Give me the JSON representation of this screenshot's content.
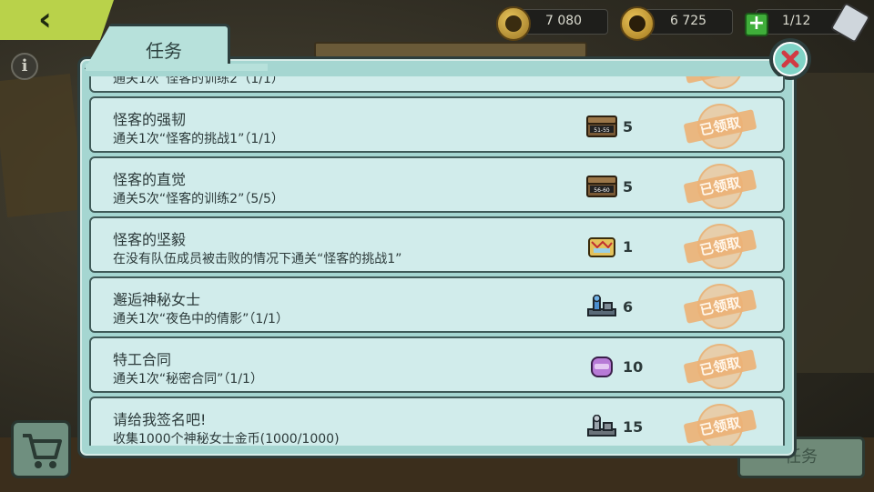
{
  "currencies": {
    "coin_a": {
      "amount": "7 080"
    },
    "coin_b": {
      "amount": "6 725"
    },
    "tickets": {
      "amount": "1/12"
    }
  },
  "dialog": {
    "title": "任务",
    "claimed_label": "已领取"
  },
  "tasks": [
    {
      "title": "",
      "desc": "通关1次“怪客的训练2”（1/1）",
      "reward_icon": "partial-hidden",
      "reward_count": ""
    },
    {
      "title": "怪客的强韧",
      "desc": "通关1次“怪客的挑战1”（1/1）",
      "reward_icon": "treasure-chest-icon",
      "chest_label": "51-55",
      "reward_count": "5"
    },
    {
      "title": "怪客的直觉",
      "desc": "通关5次“怪客的训练2”（5/5）",
      "reward_icon": "treasure-chest-icon",
      "chest_label": "56-60",
      "reward_count": "5"
    },
    {
      "title": "怪客的坚毅",
      "desc": "在没有队伍成员被击败的情况下通关“怪客的挑战1”",
      "reward_icon": "gold-case-icon",
      "reward_count": "1"
    },
    {
      "title": "邂逅神秘女士",
      "desc": "通关1次“夜色中的倩影”（1/1）",
      "reward_icon": "blue-figure-icon",
      "reward_count": "6"
    },
    {
      "title": "特工合同",
      "desc": "通关1次“秘密合同”（1/1）",
      "reward_icon": "purple-pouch-icon",
      "reward_count": "10"
    },
    {
      "title": "请给我签名吧!",
      "desc": "收集1000个神秘女士金币(1000/1000)",
      "reward_icon": "grey-figure-icon",
      "reward_count": "15"
    }
  ],
  "bottom": {
    "tasks_button_label": "任务"
  }
}
